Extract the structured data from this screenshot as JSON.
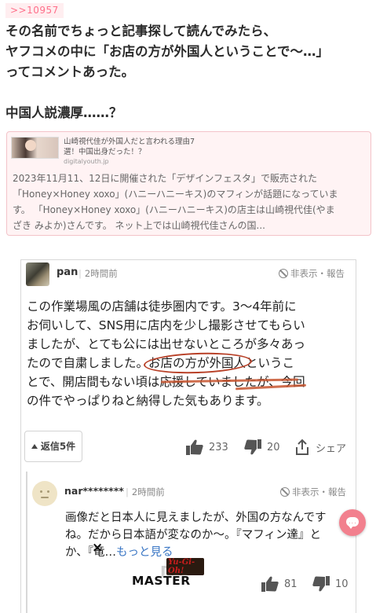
{
  "post": {
    "reply_ref": ">>10957",
    "lines": [
      "その名前でちょっと記事探して読んでみたら、",
      "ヤフコメの中に「お店の方が外国人ということで〜…」",
      "ってコメントあった。",
      "",
      "中国人説濃厚……？"
    ]
  },
  "link_card": {
    "title_line1": "山崎視代佳が外国人だと言われる理由7",
    "title_line2": "選！中国出身だった！？",
    "domain": "digitalyouth.jp",
    "desc_lines": [
      "2023年11月11、12日に開催された「デザインフェスタ」で販売された",
      "「Honey×Honey xoxo」(ハニーハニーキス)のマフィンが話題になっていま",
      "す。 「Honey×Honey xoxo」(ハニーハニーキス)の店主は山崎視代佳(やま",
      "ざき みよか)さんです。 ネット上では山崎視代佳さんの国..."
    ]
  },
  "comment1": {
    "user": "pan",
    "time": "2時間前",
    "hide_label": "非表示・報告",
    "line1": "この作業場風の店舗は徒歩圏内です。3〜4年前に",
    "line2": "お伺いして、SNS用に店内を少し撮影させてもらい",
    "line3": "ましたが、とても公には出せないところが多々あっ",
    "line4_pre": "たので自粛しました。",
    "line4_circled": "お店の方が外国人",
    "line4_post": "というこ",
    "line5": "とで、開店間もない頃は応援していましたが、今回",
    "line6": "の件でやっぱりねと納得した気もあります。",
    "replies_label": "返信5件",
    "likes": "233",
    "dislikes": "20",
    "share_label": "シェア"
  },
  "comment2": {
    "user": "nar********",
    "time": "2時間前",
    "hide_label": "非表示・報告",
    "line1": "画像だと日本人に見えましたが、外国の方なんで",
    "line1_tail": "す",
    "line2": "ね。だから日本語が変なのか〜。『マフィン達』と",
    "line3_pre": "か、『竜…",
    "more_label": "もっと見る",
    "likes": "81",
    "dislikes": "10"
  },
  "overlay": {
    "logo_top": "Yu-Gi-Oh!",
    "logo_main": "MASTER",
    "close_glyph": "×"
  },
  "colors": {
    "accent_pink": "#ff6f8a",
    "card_bg": "#fff3f4",
    "circle_marker": "#b84027",
    "link_blue": "#3a76c4",
    "fab": "#f2808e"
  }
}
